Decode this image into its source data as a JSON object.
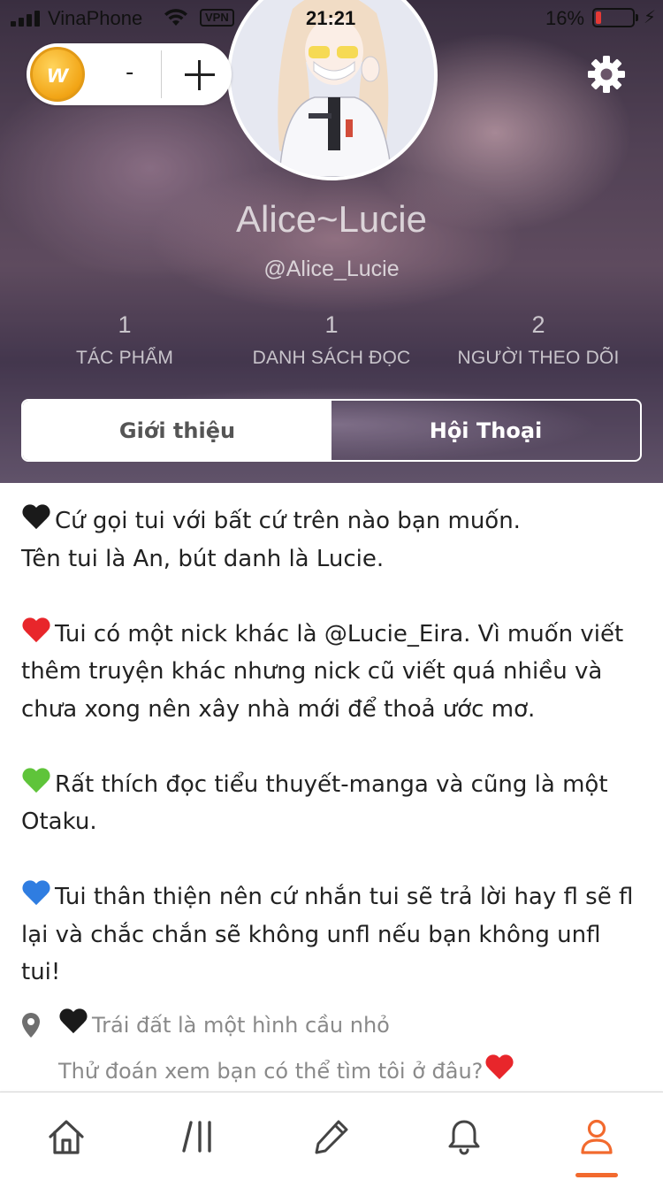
{
  "status_bar": {
    "carrier": "VinaPhone",
    "vpn": "VPN",
    "time": "21:21",
    "battery_percent": "16%",
    "battery_level": 0.16,
    "battery_color": "#e53935"
  },
  "wallet": {
    "coin_icon_letter": "w",
    "coin_value": "-",
    "add_icon": "plus-icon"
  },
  "settings_icon": "gear-icon",
  "profile": {
    "display_name": "Alice~Lucie",
    "handle": "@Alice_Lucie",
    "stats": [
      {
        "value": "1",
        "label": "TÁC PHẨM"
      },
      {
        "value": "1",
        "label": "DANH SÁCH ĐỌC"
      },
      {
        "value": "2",
        "label": "NGƯỜI THEO DÕI"
      }
    ]
  },
  "tabs": [
    {
      "label": "Giới thiệu",
      "active": true
    },
    {
      "label": "Hội Thoại",
      "active": false
    }
  ],
  "bio": {
    "paragraphs": [
      {
        "heart_color": "#1a1a1a",
        "lines": [
          "Cứ gọi tui với bất cứ trên nào bạn muốn.",
          "Tên tui là An, bút danh là Lucie."
        ]
      },
      {
        "heart_color": "#e8262b",
        "lines": [
          "Tui có một nick khác là @Lucie_Eira. Vì muốn viết thêm truyện khác nhưng nick cũ viết quá nhiều và chưa xong nên xây nhà mới để thoả ước mơ."
        ]
      },
      {
        "heart_color": "#5fc43a",
        "lines": [
          "Rất thích đọc tiểu thuyết-manga và cũng là một Otaku."
        ]
      },
      {
        "heart_color": "#2f7de1",
        "lines": [
          "Tui thân thiện nên cứ nhắn tui sẽ trả lời hay fl sẽ fl lại và chắc chắn sẽ không unfl nếu bạn không unfl tui!"
        ]
      }
    ]
  },
  "location": {
    "icon": "location-pin-icon",
    "line1": "Trái đất là một hình cầu nhỏ",
    "line1_heart_color": "#1a1a1a",
    "line2": "Thử đoán xem bạn có thể tìm tôi ở đâu?",
    "line2_heart_color": "#e8262b"
  },
  "bottom_nav": {
    "items": [
      {
        "icon": "home-icon",
        "active": false
      },
      {
        "icon": "library-icon",
        "active": false
      },
      {
        "icon": "write-pencil-icon",
        "active": false
      },
      {
        "icon": "notifications-bell-icon",
        "active": false
      },
      {
        "icon": "profile-icon",
        "active": true
      }
    ],
    "active_color": "#f26a2e",
    "inactive_color": "#444444"
  }
}
